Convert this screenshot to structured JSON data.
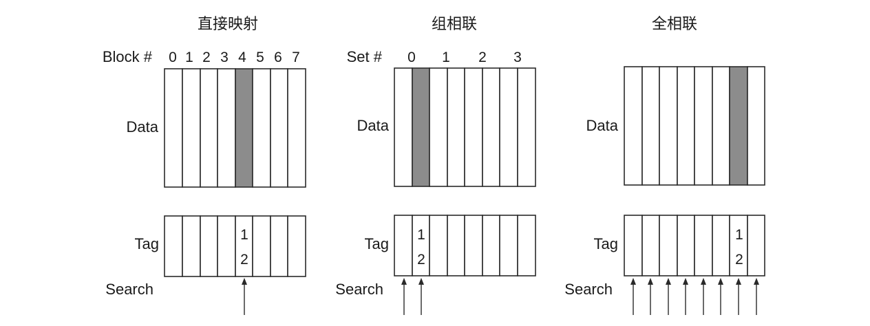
{
  "direct": {
    "title": "直接映射",
    "index_label": "Block #",
    "indices": [
      "0",
      "1",
      "2",
      "3",
      "4",
      "5",
      "6",
      "7"
    ],
    "data_label": "Data",
    "tag_label": "Tag",
    "search_label": "Search",
    "tag_text": [
      "1",
      "2"
    ],
    "highlight_block": 4
  },
  "set_assoc": {
    "title": "组相联",
    "index_label": "Set #",
    "indices": [
      "0",
      "1",
      "2",
      "3"
    ],
    "data_label": "Data",
    "tag_label": "Tag",
    "search_label": "Search",
    "tag_text": [
      "1",
      "2"
    ],
    "highlight_set": 0
  },
  "full_assoc": {
    "title": "全相联",
    "data_label": "Data",
    "tag_label": "Tag",
    "search_label": "Search",
    "tag_text": [
      "1",
      "2"
    ],
    "highlight_block": 6
  }
}
